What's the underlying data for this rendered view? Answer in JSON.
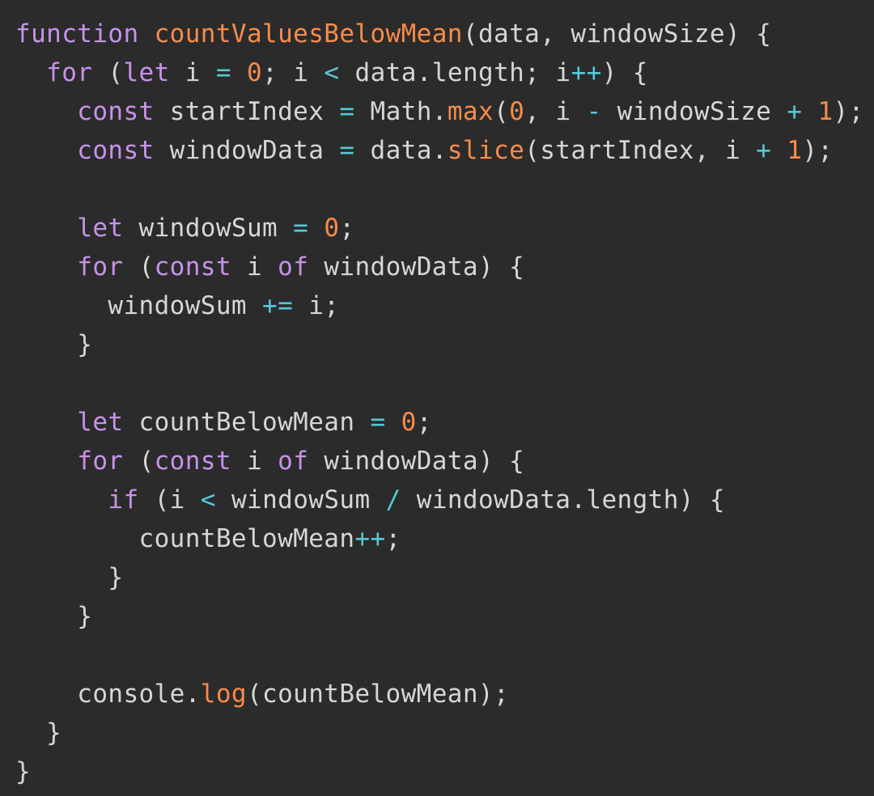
{
  "editor": {
    "colors": {
      "background": "#2b2b2b",
      "identifier": "#d6d6d6",
      "keyword": "#c792ea",
      "function": "#f78c4a",
      "number": "#f78c4a",
      "operator": "#56c8d8"
    },
    "lines": [
      {
        "tokens": [
          {
            "t": "kw",
            "v": "function"
          },
          {
            "t": "id",
            "v": " "
          },
          {
            "t": "fn",
            "v": "countValuesBelowMean"
          },
          {
            "t": "punc",
            "v": "(data, windowSize) {"
          }
        ]
      },
      {
        "tokens": [
          {
            "t": "id",
            "v": "  "
          },
          {
            "t": "kw",
            "v": "for"
          },
          {
            "t": "punc",
            "v": " ("
          },
          {
            "t": "kw",
            "v": "let"
          },
          {
            "t": "id",
            "v": " i "
          },
          {
            "t": "op",
            "v": "="
          },
          {
            "t": "id",
            "v": " "
          },
          {
            "t": "num",
            "v": "0"
          },
          {
            "t": "punc",
            "v": "; i "
          },
          {
            "t": "op",
            "v": "<"
          },
          {
            "t": "id",
            "v": " data.length; i"
          },
          {
            "t": "op",
            "v": "++"
          },
          {
            "t": "punc",
            "v": ") {"
          }
        ]
      },
      {
        "tokens": [
          {
            "t": "id",
            "v": "    "
          },
          {
            "t": "kw",
            "v": "const"
          },
          {
            "t": "id",
            "v": " startIndex "
          },
          {
            "t": "op",
            "v": "="
          },
          {
            "t": "id",
            "v": " Math."
          },
          {
            "t": "fn",
            "v": "max"
          },
          {
            "t": "punc",
            "v": "("
          },
          {
            "t": "num",
            "v": "0"
          },
          {
            "t": "punc",
            "v": ", i "
          },
          {
            "t": "op",
            "v": "-"
          },
          {
            "t": "id",
            "v": " windowSize "
          },
          {
            "t": "op",
            "v": "+"
          },
          {
            "t": "id",
            "v": " "
          },
          {
            "t": "num",
            "v": "1"
          },
          {
            "t": "punc",
            "v": ");"
          }
        ]
      },
      {
        "tokens": [
          {
            "t": "id",
            "v": "    "
          },
          {
            "t": "kw",
            "v": "const"
          },
          {
            "t": "id",
            "v": " windowData "
          },
          {
            "t": "op",
            "v": "="
          },
          {
            "t": "id",
            "v": " data."
          },
          {
            "t": "fn",
            "v": "slice"
          },
          {
            "t": "punc",
            "v": "(startIndex, i "
          },
          {
            "t": "op",
            "v": "+"
          },
          {
            "t": "id",
            "v": " "
          },
          {
            "t": "num",
            "v": "1"
          },
          {
            "t": "punc",
            "v": ");"
          }
        ]
      },
      {
        "tokens": [
          {
            "t": "id",
            "v": ""
          }
        ]
      },
      {
        "tokens": [
          {
            "t": "id",
            "v": "    "
          },
          {
            "t": "kw",
            "v": "let"
          },
          {
            "t": "id",
            "v": " windowSum "
          },
          {
            "t": "op",
            "v": "="
          },
          {
            "t": "id",
            "v": " "
          },
          {
            "t": "num",
            "v": "0"
          },
          {
            "t": "punc",
            "v": ";"
          }
        ]
      },
      {
        "tokens": [
          {
            "t": "id",
            "v": "    "
          },
          {
            "t": "kw",
            "v": "for"
          },
          {
            "t": "punc",
            "v": " ("
          },
          {
            "t": "kw",
            "v": "const"
          },
          {
            "t": "id",
            "v": " i "
          },
          {
            "t": "kw",
            "v": "of"
          },
          {
            "t": "id",
            "v": " windowData) {"
          }
        ]
      },
      {
        "tokens": [
          {
            "t": "id",
            "v": "      windowSum "
          },
          {
            "t": "op",
            "v": "+="
          },
          {
            "t": "id",
            "v": " i;"
          }
        ]
      },
      {
        "tokens": [
          {
            "t": "id",
            "v": "    }"
          }
        ]
      },
      {
        "tokens": [
          {
            "t": "id",
            "v": ""
          }
        ]
      },
      {
        "tokens": [
          {
            "t": "id",
            "v": "    "
          },
          {
            "t": "kw",
            "v": "let"
          },
          {
            "t": "id",
            "v": " countBelowMean "
          },
          {
            "t": "op",
            "v": "="
          },
          {
            "t": "id",
            "v": " "
          },
          {
            "t": "num",
            "v": "0"
          },
          {
            "t": "punc",
            "v": ";"
          }
        ]
      },
      {
        "tokens": [
          {
            "t": "id",
            "v": "    "
          },
          {
            "t": "kw",
            "v": "for"
          },
          {
            "t": "punc",
            "v": " ("
          },
          {
            "t": "kw",
            "v": "const"
          },
          {
            "t": "id",
            "v": " i "
          },
          {
            "t": "kw",
            "v": "of"
          },
          {
            "t": "id",
            "v": " windowData) {"
          }
        ]
      },
      {
        "tokens": [
          {
            "t": "id",
            "v": "      "
          },
          {
            "t": "kw",
            "v": "if"
          },
          {
            "t": "punc",
            "v": " (i "
          },
          {
            "t": "op",
            "v": "<"
          },
          {
            "t": "id",
            "v": " windowSum "
          },
          {
            "t": "op",
            "v": "/"
          },
          {
            "t": "id",
            "v": " windowData.length) {"
          }
        ]
      },
      {
        "tokens": [
          {
            "t": "id",
            "v": "        countBelowMean"
          },
          {
            "t": "op",
            "v": "++"
          },
          {
            "t": "punc",
            "v": ";"
          }
        ]
      },
      {
        "tokens": [
          {
            "t": "id",
            "v": "      }"
          }
        ]
      },
      {
        "tokens": [
          {
            "t": "id",
            "v": "    }"
          }
        ]
      },
      {
        "tokens": [
          {
            "t": "id",
            "v": ""
          }
        ]
      },
      {
        "tokens": [
          {
            "t": "id",
            "v": "    console."
          },
          {
            "t": "fn",
            "v": "log"
          },
          {
            "t": "punc",
            "v": "(countBelowMean);"
          }
        ]
      },
      {
        "tokens": [
          {
            "t": "id",
            "v": "  }"
          }
        ]
      },
      {
        "tokens": [
          {
            "t": "id",
            "v": "}"
          }
        ]
      }
    ]
  }
}
